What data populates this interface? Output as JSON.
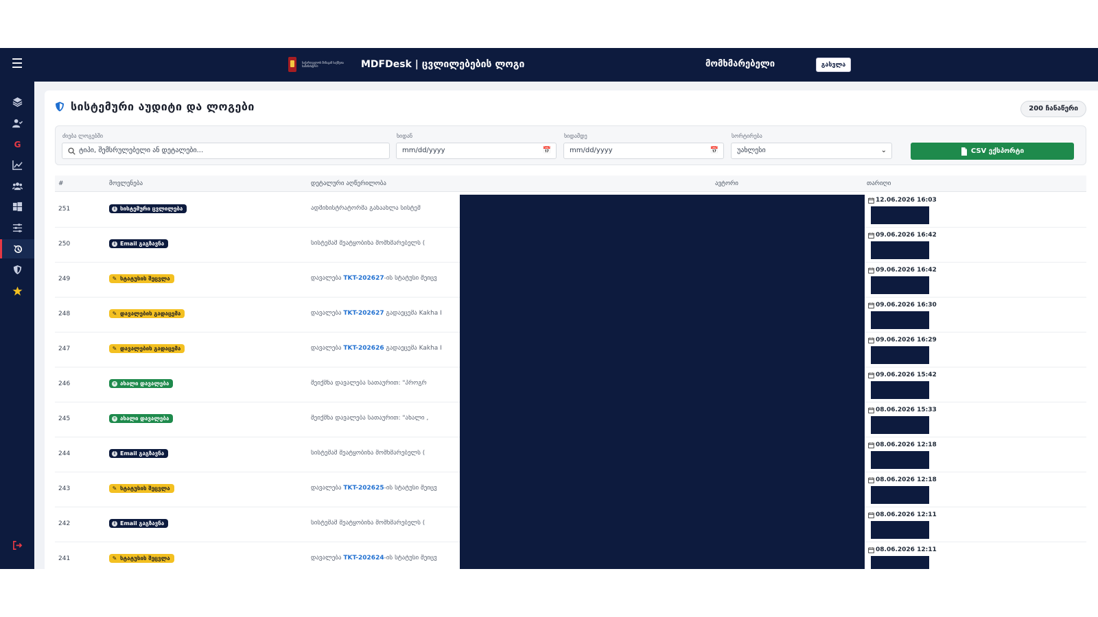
{
  "header": {
    "app_title": "MDFDesk | ცვლილებების ლოგი",
    "logo_text": "საქართველოს შინაგან საქმეთა სამინისტრო",
    "user_name": "მომხმარებელი",
    "logout_label": "გასვლა"
  },
  "sidebar": {
    "items": [
      {
        "icon": "layers-icon"
      },
      {
        "icon": "user-check-icon"
      },
      {
        "icon": "google-icon"
      },
      {
        "icon": "chart-line-icon"
      },
      {
        "icon": "users-icon"
      },
      {
        "icon": "windows-icon"
      },
      {
        "icon": "sliders-icon"
      },
      {
        "icon": "history-icon",
        "active": true
      },
      {
        "icon": "shield-icon"
      },
      {
        "icon": "star-icon"
      }
    ],
    "logout_icon": "sign-out-icon"
  },
  "page": {
    "title": "სისტემური აუდიტი და ლოგები",
    "records_badge": "200 ჩანაწერი"
  },
  "filters": {
    "search_label": "ძიება ლოგებში",
    "search_placeholder": "ტიპი, შემსრულებელი ან დეტალები...",
    "date_from_label": "ხიდან",
    "date_from_value": "mm/dd/yyyy",
    "date_to_label": "ხიდამდე",
    "date_to_value": "mm/dd/yyyy",
    "sort_label": "სორტირება",
    "sort_value": "უახლესი",
    "export_label": "CSV ექსპორტი"
  },
  "table": {
    "columns": {
      "num": "#",
      "event": "მოვლენება",
      "details": "დეტალური აღწერილობა",
      "author": "ავტორი",
      "date": "თარიღი"
    },
    "rows": [
      {
        "num": "251",
        "badge": "სისტემური ცვლილება",
        "badge_style": "dark",
        "desc_pre": "ადმინისტრატორმა განაახლა სისტემ",
        "link": "",
        "desc_post": "",
        "date": "12.06.2026 16:03"
      },
      {
        "num": "250",
        "badge": "Email გაგზავნა",
        "badge_style": "dark",
        "desc_pre": "სისტემამ შეატყობინა მომხმარებელს (",
        "link": "",
        "desc_post": "",
        "date": "09.06.2026 16:42"
      },
      {
        "num": "249",
        "badge": "სტატუსის შეცვლა",
        "badge_style": "yellow",
        "desc_pre": "დავალება ",
        "link": "TKT-202627",
        "desc_post": "-ის სტატუსი შეიცვ",
        "date": "09.06.2026 16:42"
      },
      {
        "num": "248",
        "badge": "დავალების გადაცემა",
        "badge_style": "yellow",
        "desc_pre": "დავალება ",
        "link": "TKT-202627",
        "desc_post": " გადაეცემა Kakha I",
        "date": "09.06.2026 16:30"
      },
      {
        "num": "247",
        "badge": "დავალების გადაცემა",
        "badge_style": "yellow",
        "desc_pre": "დავალება ",
        "link": "TKT-202626",
        "desc_post": " გადაეცემა Kakha I",
        "date": "09.06.2026 16:29"
      },
      {
        "num": "246",
        "badge": "ახალი დავალება",
        "badge_style": "green",
        "desc_pre": "შეიქმნა დავალება სათაურით: \"პროგრ",
        "link": "",
        "desc_post": "",
        "date": "09.06.2026 15:42"
      },
      {
        "num": "245",
        "badge": "ახალი დავალება",
        "badge_style": "green",
        "desc_pre": "შეიქმნა დავალება სათაურით: \"ახალი ,",
        "link": "",
        "desc_post": "",
        "date": "08.06.2026 15:33"
      },
      {
        "num": "244",
        "badge": "Email გაგზავნა",
        "badge_style": "dark",
        "desc_pre": "სისტემამ შეატყობინა მომხმარებელს (",
        "link": "",
        "desc_post": "",
        "date": "08.06.2026 12:18"
      },
      {
        "num": "243",
        "badge": "სტატუსის შეცვლა",
        "badge_style": "yellow",
        "desc_pre": "დავალება ",
        "link": "TKT-202625",
        "desc_post": "-ის სტატუსი შეიცვ",
        "date": "08.06.2026 12:18"
      },
      {
        "num": "242",
        "badge": "Email გაგზავნა",
        "badge_style": "dark",
        "desc_pre": "სისტემამ შეატყობინა მომხმარებელს (",
        "link": "",
        "desc_post": "",
        "date": "08.06.2026 12:11"
      },
      {
        "num": "241",
        "badge": "სტატუსის შეცვლა",
        "badge_style": "yellow",
        "desc_pre": "დავალება ",
        "link": "TKT-202624",
        "desc_post": "-ის სტატუსი შეიცვ",
        "date": "08.06.2026 12:11"
      }
    ]
  },
  "colors": {
    "navy": "#0d1b3e",
    "accent_red": "#e53945",
    "success_green": "#1e8a4c",
    "warning_yellow": "#f3c021",
    "link_blue": "#1f6fd0"
  }
}
